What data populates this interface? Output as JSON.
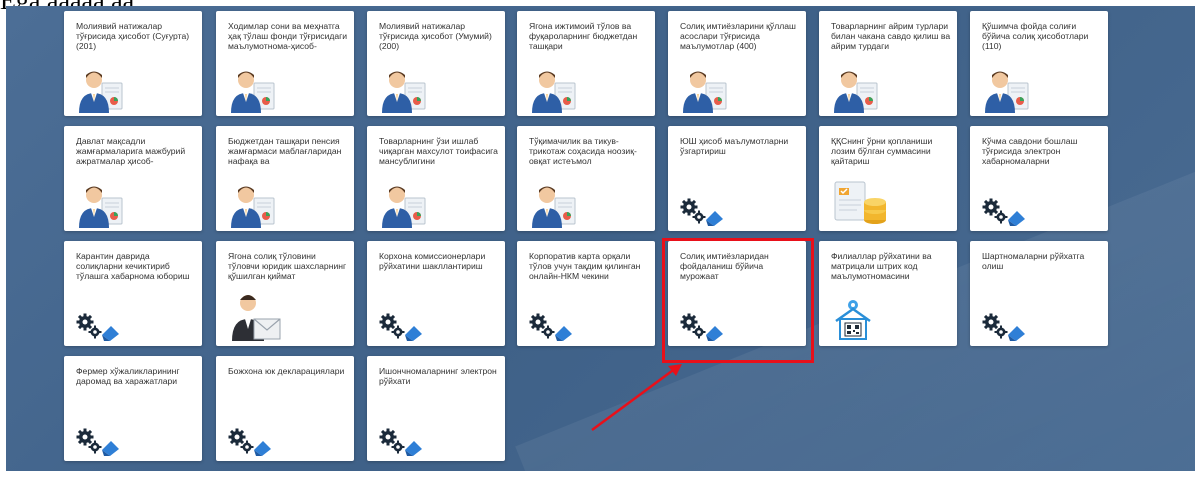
{
  "header_text": "Egá áaááá áá",
  "tiles": [
    {
      "label": "Молиявий натижалар тўғрисида ҳисобот (Суғурта) (201)",
      "icon": "person-document-icon"
    },
    {
      "label": "Ходимлар сони ва меҳнатга ҳақ тўлаш фонди тўғрисидаги маълумотнома-ҳисоб-",
      "icon": "person-document-icon"
    },
    {
      "label": "Молиявий натижалар тўғрисида ҳисобот (Умумий) (200)",
      "icon": "person-document-icon"
    },
    {
      "label": "Ягона ижтимоий тўлов ва фуқароларнинг бюджетдан ташқари",
      "icon": "person-document-icon"
    },
    {
      "label": "Солиқ имтиёзларини қўллаш асослари тўғрисида маълумотлар (400)",
      "icon": "person-document-icon"
    },
    {
      "label": "Товарларнинг айрим турлари билан чакана савдо қилиш ва айрим турдаги",
      "icon": "person-document-icon"
    },
    {
      "label": "Қўшимча фойда солиғи бўйича солиқ ҳисоботлари (110)",
      "icon": "person-document-icon"
    },
    {
      "label": "Давлат мақсадли жамғармаларига мажбурий ажратмалар ҳисоб-",
      "icon": "person-document-icon"
    },
    {
      "label": "Бюджетдан ташқари пенсия жамғармаси маблағларидан нафақа ва",
      "icon": "person-document-icon"
    },
    {
      "label": "Товарларнинг ўзи ишлаб чиқарган махсулот тоифасига мансублигини",
      "icon": "person-document-icon"
    },
    {
      "label": "Тўқимачилик ва тикув-трикотаж соҳасида ноозиқ-овқат истеъмол",
      "icon": "person-document-icon"
    },
    {
      "label": "ЮШ ҳисоб маълумотларни ўзгартириш",
      "icon": "gears-icon"
    },
    {
      "label": "ҚҚСнинг ўрни қопланиши лозим бўлган суммасини қайтариш",
      "icon": "coins-document-icon"
    },
    {
      "label": "Кўчма савдони бошлаш тўғрисида электрон хабарномаларни",
      "icon": "gears-icon"
    },
    {
      "label": "Карантин даврида солиқларни кечиктириб тўлашга хабарнома юбориш",
      "icon": "gears-icon"
    },
    {
      "label": "Ягона солиқ тўловини тўловчи юридик шахсларнинг қўшилган қиймат",
      "icon": "person-mail-icon"
    },
    {
      "label": "Корхона комиссионерлари рўйхатини шакллантириш",
      "icon": "gears-icon"
    },
    {
      "label": "Корпоратив карта орқали тўлов учун тақдим қилинган онлайн-НКМ чекини",
      "icon": "gears-icon"
    },
    {
      "label": "Солиқ имтиёзларидан фойдаланиш бўйича мурожаат",
      "icon": "gears-icon"
    },
    {
      "label": "Филиаллар рўйхатини ва матрицали штрих код маълумотномасини",
      "icon": "building-qr-icon"
    },
    {
      "label": "Шартномаларни рўйхатга олиш",
      "icon": "gears-icon"
    },
    {
      "label": "Фермер хўжаликларининг даромад ва харажатлари",
      "icon": "gears-icon"
    },
    {
      "label": "Божхона юк декларациялари",
      "icon": "gears-icon"
    },
    {
      "label": "Ишончномаларнинг электрон рўйхати",
      "icon": "gears-icon"
    }
  ],
  "highlighted_tile": "Солиқ имтиёзларидан фойдаланиш бўйича мурожаат",
  "colors": {
    "background": "#44668e",
    "tile": "#ffffff",
    "highlight": "#e8101a",
    "gear": "#1b2a3a",
    "accent_blue": "#2f7fd6"
  }
}
